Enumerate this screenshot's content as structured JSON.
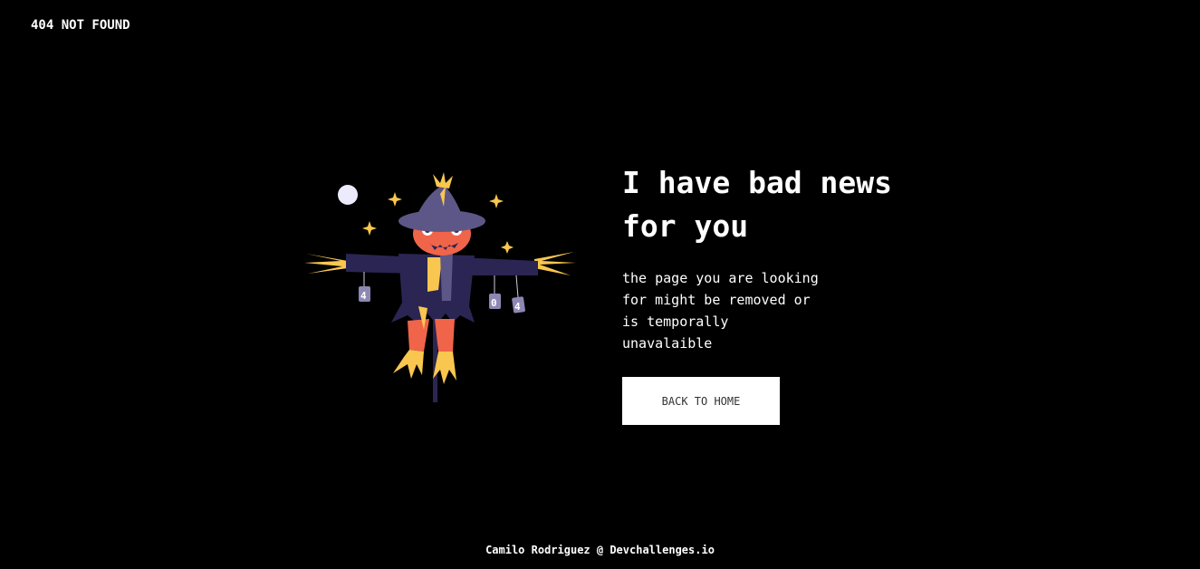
{
  "header": {
    "logo_text": "404 NOT FOUND"
  },
  "main": {
    "headline": "I have bad news for you",
    "message": "the page you are looking for might be removed or is temporally unavalaible",
    "back_button_label": "BACK TO HOME",
    "illustration": {
      "icon": "scarecrow-icon",
      "sign_digits": [
        "4",
        "0",
        "4"
      ]
    }
  },
  "footer": {
    "credit": "Camilo Rodriguez @ Devchallenges.io"
  },
  "colors": {
    "background": "#000000",
    "text": "#ffffff",
    "button_bg": "#ffffff",
    "button_text": "#333333",
    "scarecrow_coat": "#2b2553",
    "scarecrow_face": "#f06449",
    "straw": "#f9c74f"
  }
}
